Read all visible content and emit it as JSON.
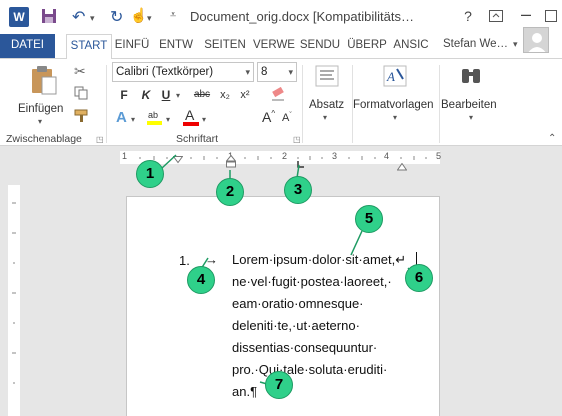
{
  "titlebar": {
    "title": "Document_orig.docx [Kompatibilitäts…",
    "word_icon": "W",
    "help": "?"
  },
  "tabs": [
    "DATEI",
    "START",
    "EINFÜ",
    "ENTW",
    "SEITEN",
    "VERWE",
    "SENDU",
    "ÜBERP",
    "ANSIC"
  ],
  "user": {
    "name": "Stefan We…"
  },
  "ribbon": {
    "paste_label": "Einfügen",
    "clipboard_group": "Zwischenablage",
    "font_group": "Schriftart",
    "font_name": "Calibri (Textkörper)",
    "font_size": "8",
    "paragraph_label": "Absatz",
    "styles_label": "Formatvorlagen",
    "edit_label": "Bearbeiten",
    "bold": "F",
    "italic": "K",
    "underline": "U",
    "strike": "abc",
    "sub": "x₂",
    "sup": "x²",
    "font_color": "A",
    "grow": "A",
    "shrink": "A",
    "change_case": "Aa"
  },
  "ruler": {
    "numbers": [
      "1",
      "1",
      "2",
      "3",
      "4",
      "5"
    ]
  },
  "document": {
    "list_number": "1.",
    "tab_mark": "→",
    "lines": [
      "Lorem·ipsum·dolor·sit·amet,↵",
      "ne·vel·fugit·postea·laoreet,·",
      "eam·oratio·omnesque·",
      "deleniti·te,·ut·aeterno·",
      "dissentias·consequuntur·",
      "pro.·Qui·tale·soluta·eruditi·",
      "an.¶"
    ]
  },
  "callouts": [
    "1",
    "2",
    "3",
    "4",
    "5",
    "6",
    "7"
  ],
  "colors": {
    "accent": "#2b579a",
    "callout": "#2fd08a"
  }
}
